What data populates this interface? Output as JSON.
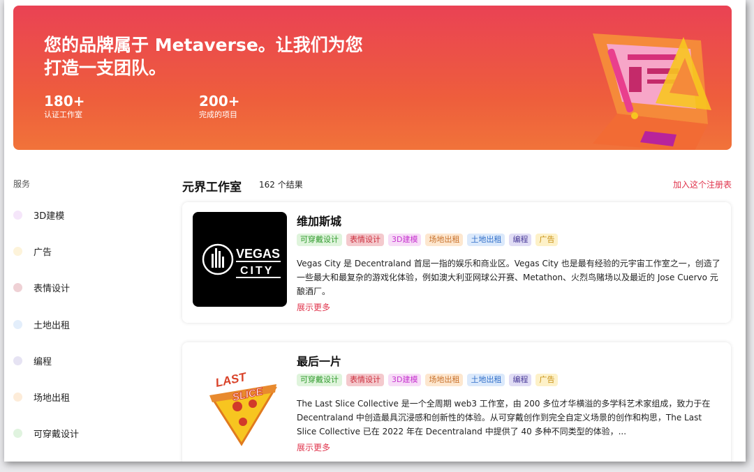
{
  "hero": {
    "title": "您的品牌属于 Metaverse。让我们为您打造一支团队。",
    "stats": [
      {
        "value": "180+",
        "label": "认证工作室"
      },
      {
        "value": "200+",
        "label": "完成的项目"
      }
    ]
  },
  "sidebar": {
    "title": "服务",
    "items": [
      {
        "label": "3D建模",
        "color": "#f5e6fa"
      },
      {
        "label": "广告",
        "color": "#fdf3da"
      },
      {
        "label": "表情设计",
        "color": "#efd1d5"
      },
      {
        "label": "土地出租",
        "color": "#e3eefb"
      },
      {
        "label": "编程",
        "color": "#e6e3f3"
      },
      {
        "label": "场地出租",
        "color": "#fdecd9"
      },
      {
        "label": "可穿戴设计",
        "color": "#e0f3df"
      }
    ]
  },
  "main": {
    "title": "元界工作室",
    "result_count": "162 个结果",
    "join_link": "加入这个注册表"
  },
  "tags": [
    {
      "label": "可穿戴设计",
      "bg": "#dff4dc",
      "fg": "#2f9a2c"
    },
    {
      "label": "表情设计",
      "bg": "#f4c9cd",
      "fg": "#cc2f3e"
    },
    {
      "label": "3D建模",
      "bg": "#f7dcf7",
      "fg": "#c734cf"
    },
    {
      "label": "场地出租",
      "bg": "#fde7cf",
      "fg": "#c8702a"
    },
    {
      "label": "土地出租",
      "bg": "#dbe9fb",
      "fg": "#2f6ec9"
    },
    {
      "label": "编程",
      "bg": "#e1ddf5",
      "fg": "#4b3c9a"
    },
    {
      "label": "广告",
      "bg": "#fdf1c8",
      "fg": "#c78f12"
    }
  ],
  "studios": [
    {
      "name": "维加斯城",
      "description": "Vegas City 是 Decentraland 首屈一指的娱乐和商业区。Vegas City 也是最有经验的元宇宙工作室之一，创造了一些最大和最复杂的游戏化体验，例如澳大利亚网球公开赛、Metathon、火烈鸟赌场以及最近的 Jose Cuervo 元酿酒厂。",
      "more": "展示更多",
      "logo_line1": "VEGAS",
      "logo_line2": "CITY"
    },
    {
      "name": "最后一片",
      "description": "The Last Slice Collective 是一个全周期 web3 工作室，由 200 多位才华横溢的多学科艺术家组成，致力于在 Decentraland 中创造最具沉浸感和创新性的体验。从可穿戴创作到完全自定义场景的创作和构思，The Last Slice Collective 已在 2022 年在 Decentraland 中提供了 40 多种不同类型的体验，...",
      "more": "展示更多",
      "logo_line1": "LAST",
      "logo_line2": "SLICE"
    }
  ]
}
